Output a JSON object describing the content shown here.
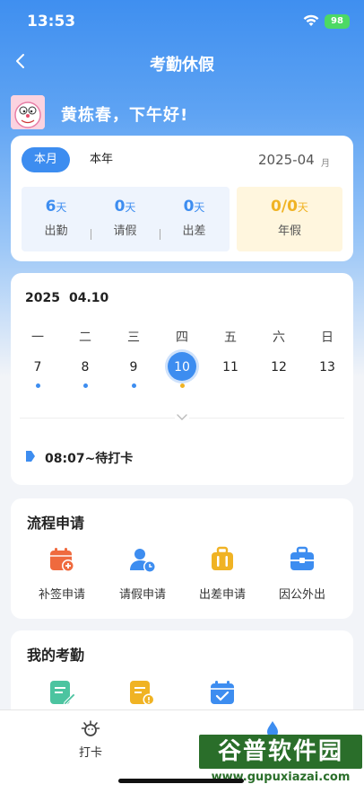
{
  "status_bar": {
    "time": "13:53",
    "battery": "98"
  },
  "nav": {
    "title": "考勤休假"
  },
  "greeting": "黄栋春，下午好!",
  "summary": {
    "tabs": [
      {
        "label": "本月",
        "active": true
      },
      {
        "label": "本年",
        "active": false
      }
    ],
    "month": "2025-04",
    "month_unit": "月",
    "stats": [
      {
        "value": "6",
        "unit": "天",
        "label": "出勤"
      },
      {
        "value": "0",
        "unit": "天",
        "label": "请假"
      },
      {
        "value": "0",
        "unit": "天",
        "label": "出差"
      }
    ],
    "leave": {
      "value": "0/0",
      "unit": "天",
      "label": "年假"
    },
    "separator": "|"
  },
  "calendar": {
    "year": "2025",
    "date": "04.10",
    "weekdays": [
      "一",
      "二",
      "三",
      "四",
      "五",
      "六",
      "日"
    ],
    "days": [
      "7",
      "8",
      "9",
      "10",
      "11",
      "12",
      "13"
    ],
    "selected_day": "10",
    "punch_text": "08:07~待打卡"
  },
  "process": {
    "title": "流程申请",
    "items": [
      {
        "label": "补签申请",
        "icon": "calendar-plus-icon"
      },
      {
        "label": "请假申请",
        "icon": "user-clock-icon"
      },
      {
        "label": "出差申请",
        "icon": "suitcase-icon"
      },
      {
        "label": "因公外出",
        "icon": "briefcase-icon"
      }
    ]
  },
  "attendance": {
    "title": "我的考勤",
    "icons": [
      "edit-note-icon",
      "alert-document-icon",
      "calendar-check-icon"
    ]
  },
  "tabbar": {
    "items": [
      {
        "label": "打卡"
      }
    ]
  },
  "watermark": {
    "logo": "谷普软件园",
    "url": "www.gupuxiazai.com"
  },
  "colors": {
    "primary": "#3d8df0",
    "orange": "#ef6a3e",
    "yellow": "#f0b324",
    "leave_bg": "#fff6de"
  }
}
